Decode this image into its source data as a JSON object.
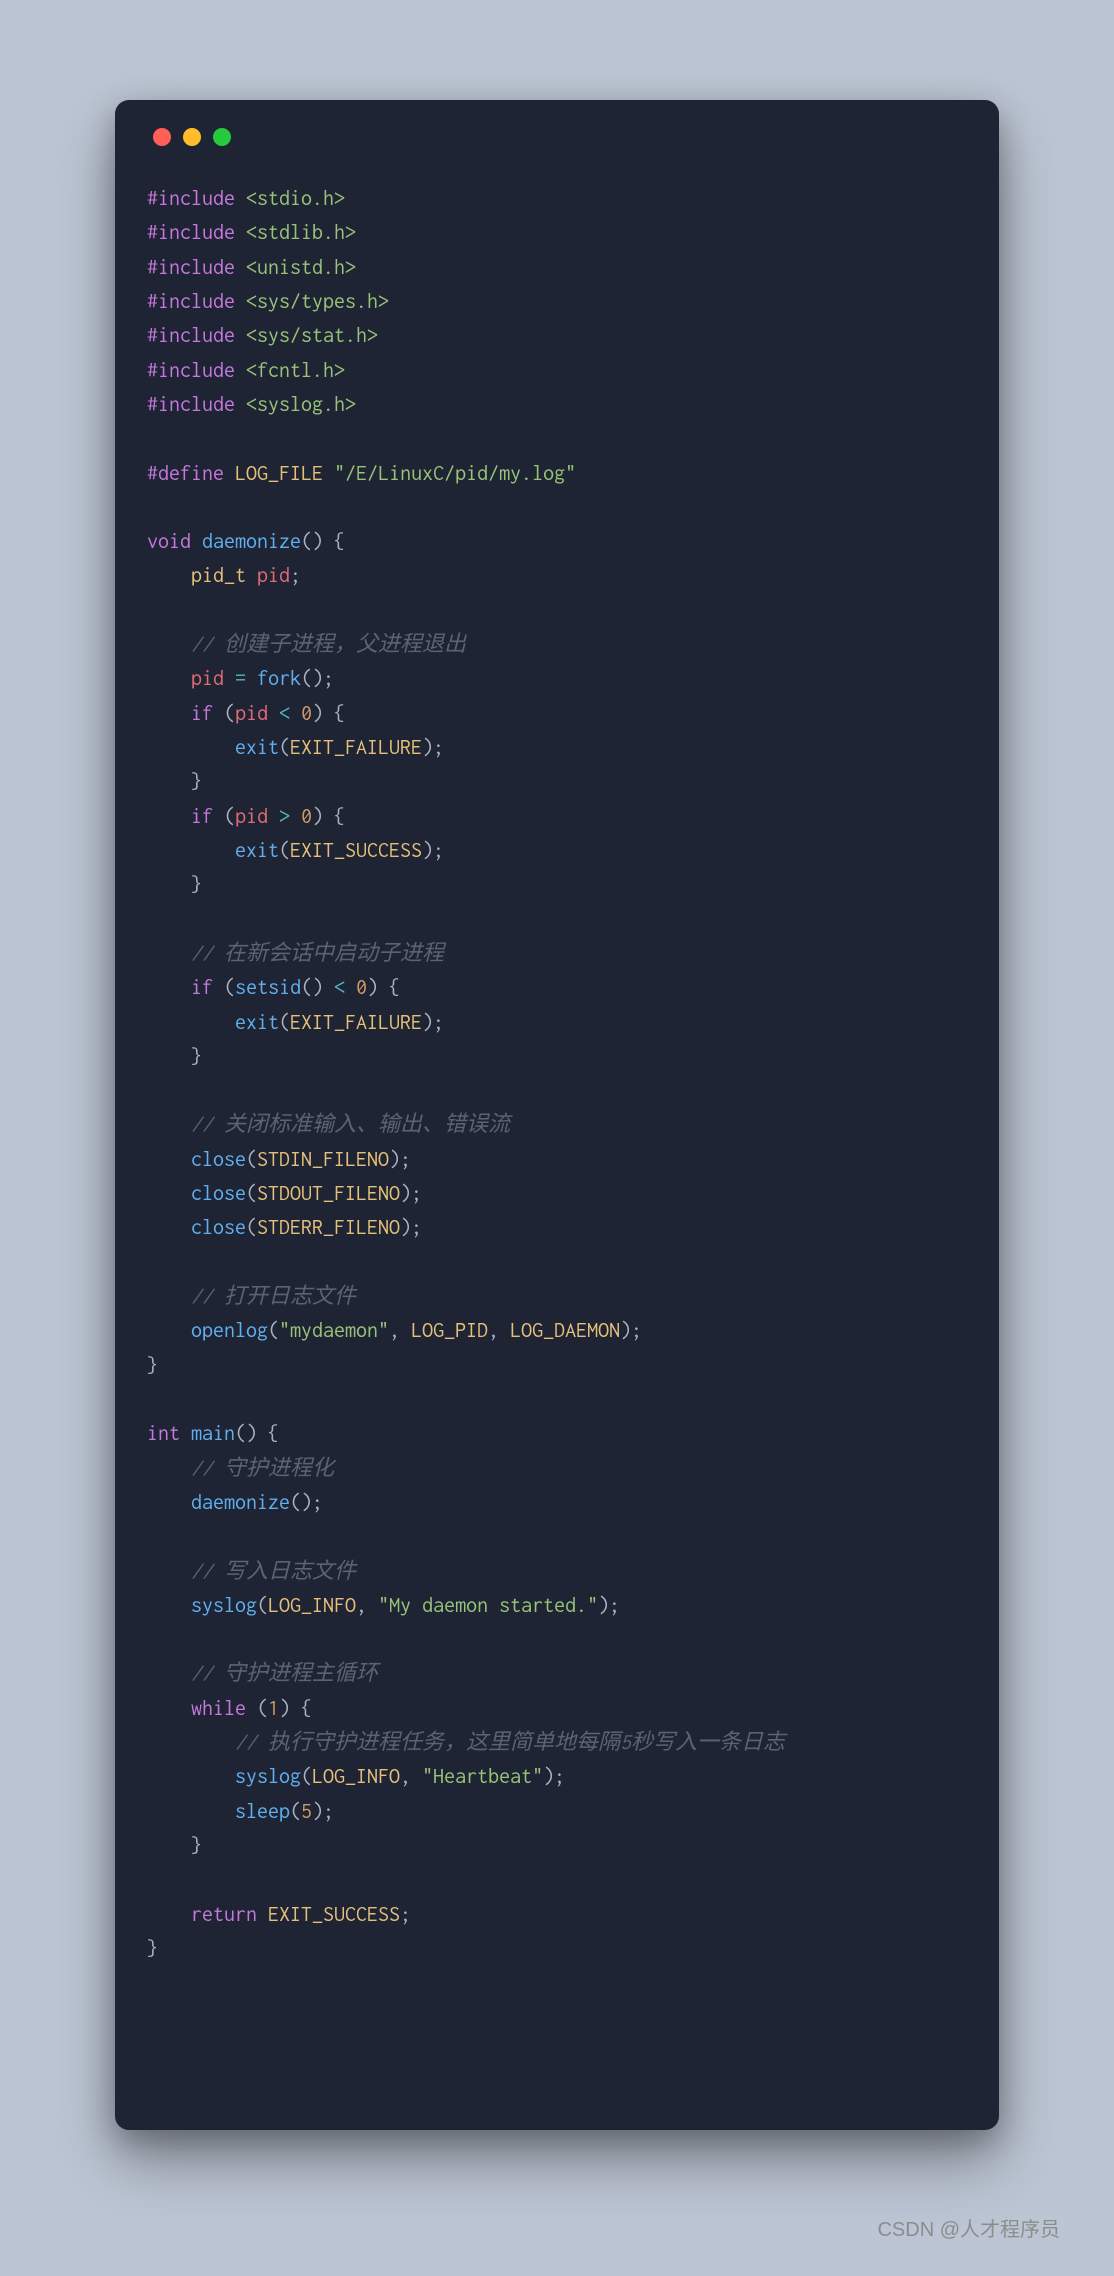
{
  "watermark": "CSDN @人才程序员",
  "code": {
    "includes": [
      {
        "directive": "#include",
        "path": "<stdio.h>"
      },
      {
        "directive": "#include",
        "path": "<stdlib.h>"
      },
      {
        "directive": "#include",
        "path": "<unistd.h>"
      },
      {
        "directive": "#include",
        "path": "<sys/types.h>"
      },
      {
        "directive": "#include",
        "path": "<sys/stat.h>"
      },
      {
        "directive": "#include",
        "path": "<fcntl.h>"
      },
      {
        "directive": "#include",
        "path": "<syslog.h>"
      }
    ],
    "define": {
      "directive": "#define",
      "name": "LOG_FILE",
      "value": "\"/E/LinuxC/pid/my.log\""
    },
    "daemonize": {
      "ret": "void",
      "name": "daemonize",
      "pid_type": "pid_t",
      "pid_var": "pid",
      "c_fork": "// 创建子进程，父进程退出",
      "fork": "fork",
      "zero": "0",
      "exit": "exit",
      "fail": "EXIT_FAILURE",
      "succ": "EXIT_SUCCESS",
      "c_setsid": "// 在新会话中启动子进程",
      "setsid": "setsid",
      "c_close": "// 关闭标准输入、输出、错误流",
      "close": "close",
      "stdin": "STDIN_FILENO",
      "stdout": "STDOUT_FILENO",
      "stderr": "STDERR_FILENO",
      "c_openlog": "// 打开日志文件",
      "openlog": "openlog",
      "ol_name": "\"mydaemon\"",
      "ol_pid": "LOG_PID",
      "ol_daemon": "LOG_DAEMON",
      "kw_if": "if"
    },
    "main": {
      "ret": "int",
      "name": "main",
      "c_daemonize": "// 守护进程化",
      "call_daemonize": "daemonize",
      "c_syslog": "// 写入日志文件",
      "syslog": "syslog",
      "loginfo": "LOG_INFO",
      "msg_started": "\"My daemon started.\"",
      "c_loop": "// 守护进程主循环",
      "kw_while": "while",
      "one": "1",
      "c_task": "// 执行守护进程任务，这里简单地每隔5秒写入一条日志",
      "msg_heartbeat": "\"Heartbeat\"",
      "sleep": "sleep",
      "five": "5",
      "kw_return": "return",
      "ret_val": "EXIT_SUCCESS"
    }
  }
}
